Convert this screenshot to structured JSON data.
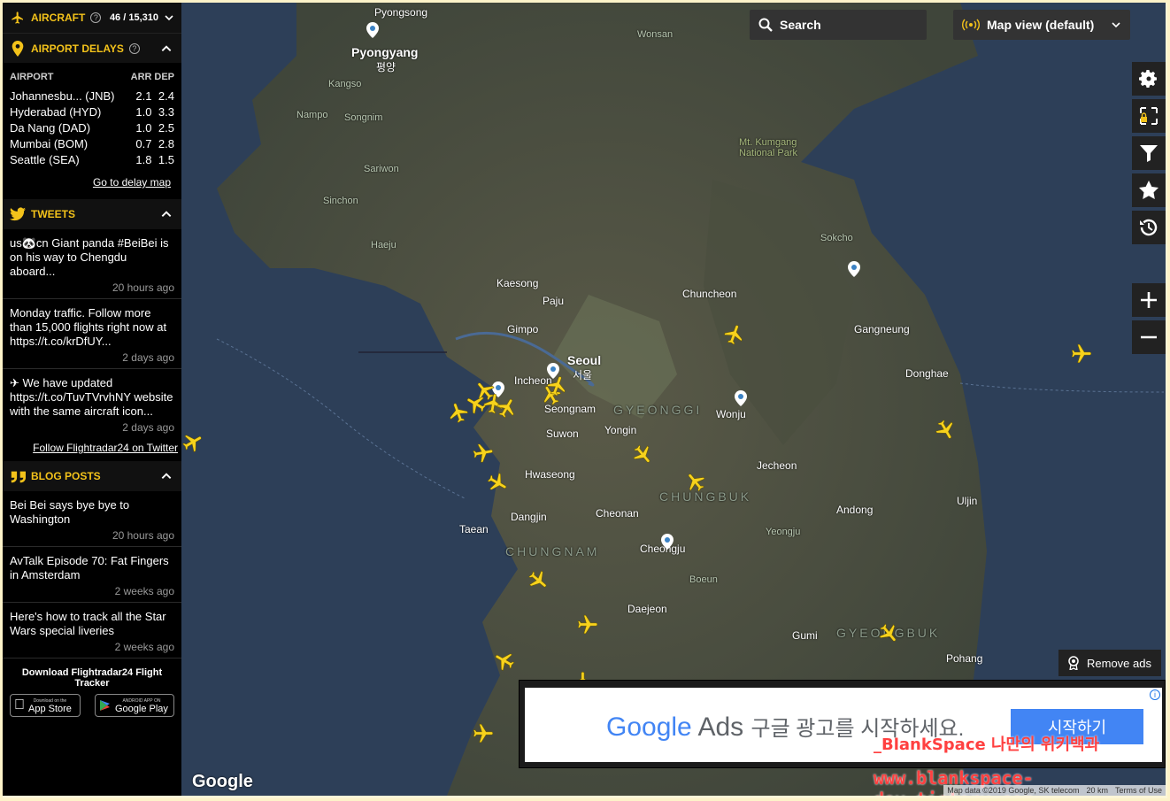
{
  "aircraft": {
    "label": "AIRCRAFT",
    "count": "46 / 15,310"
  },
  "delays": {
    "label": "AIRPORT DELAYS",
    "columns": [
      "AIRPORT",
      "ARR",
      "DEP"
    ],
    "rows": [
      {
        "airport": "Johannesbu... (JNB)",
        "arr": "2.1",
        "dep": "2.4"
      },
      {
        "airport": "Hyderabad (HYD)",
        "arr": "1.0",
        "dep": "3.3"
      },
      {
        "airport": "Da Nang (DAD)",
        "arr": "1.0",
        "dep": "2.5"
      },
      {
        "airport": "Mumbai (BOM)",
        "arr": "0.7",
        "dep": "2.8"
      },
      {
        "airport": "Seattle (SEA)",
        "arr": "1.8",
        "dep": "1.5"
      }
    ],
    "link": "Go to delay map"
  },
  "tweets": {
    "label": "TWEETS",
    "items": [
      {
        "text": "us🐼cn Giant panda #BeiBei is on his way to Chengdu aboard...",
        "time": "20 hours ago"
      },
      {
        "text": "Monday traffic. Follow more than 15,000 flights right now at https://t.co/krDfUY...",
        "time": "2 days ago"
      },
      {
        "text": "✈ We have updated https://t.co/TuvTVrvhNY website with the same aircraft icon...",
        "time": "2 days ago"
      }
    ],
    "link": "Follow Flightradar24 on Twitter"
  },
  "blog": {
    "label": "BLOG POSTS",
    "items": [
      {
        "text": "Bei Bei says bye bye to Washington",
        "time": "20 hours ago"
      },
      {
        "text": "AvTalk Episode 70: Fat Fingers in Amsterdam",
        "time": "2 weeks ago"
      },
      {
        "text": "Here's how to track all the Star Wars special liveries",
        "time": "2 weeks ago"
      }
    ]
  },
  "download": {
    "title": "Download Flightradar24 Flight Tracker",
    "appstore_small": "Download on the",
    "appstore": "App Store",
    "gplay_small": "ANDROID APP ON",
    "gplay": "Google Play"
  },
  "map": {
    "search": "Search",
    "view": "Map view (default)",
    "remove_ads": "Remove ads",
    "google": "Google",
    "attribution": [
      "Map data ©2019 Google, SK telecom",
      "20 km",
      "Terms of Use"
    ]
  },
  "ad": {
    "brand_google": "Google",
    "brand_ads": "Ads",
    "text": "구글 광고를 시작하세요.",
    "button": "시작하기"
  },
  "watermark": {
    "line1": "_BlankSpace 나만의 위키백과",
    "line2": "www.blankspace-dev.tistory.com"
  },
  "places": {
    "pyongsong": "Pyongsong",
    "pyongyang": "Pyongyang",
    "pyongyang_kr": "평양",
    "wonsan": "Wonsan",
    "kangso": "Kangso",
    "nampo": "Nampo",
    "songnim": "Songnim",
    "sariwon": "Sariwon",
    "sinchon": "Sinchon",
    "haeju": "Haeju",
    "kaesong": "Kaesong",
    "paju": "Paju",
    "gimpo": "Gimpo",
    "seoul": "Seoul",
    "seoul_kr": "서울",
    "incheon": "Incheon",
    "seongnam": "Seongnam",
    "suwon": "Suwon",
    "hwaseong": "Hwaseong",
    "yongin": "Yongin",
    "cheonan": "Cheonan",
    "cheongju": "Cheongju",
    "taean": "Taean",
    "dangjin": "Dangjin",
    "chuncheon": "Chuncheon",
    "gangneung": "Gangneung",
    "sokcho": "Sokcho",
    "donghae": "Donghae",
    "wonju": "Wonju",
    "jecheon": "Jecheon",
    "andong": "Andong",
    "daejeon": "Daejeon",
    "gumi": "Gumi",
    "pohang": "Pohang",
    "uljin": "Uljin",
    "yeongju": "Yeongju",
    "boeun": "Boeun",
    "mt_kumgang": "Mt. Kumgang National Park",
    "chungnam": "CHUNGNAM",
    "gyeonggi": "GYEONGGI",
    "chungbuk": "CHUNGBUK",
    "gyeongbuk": "GYEONGBUK"
  }
}
